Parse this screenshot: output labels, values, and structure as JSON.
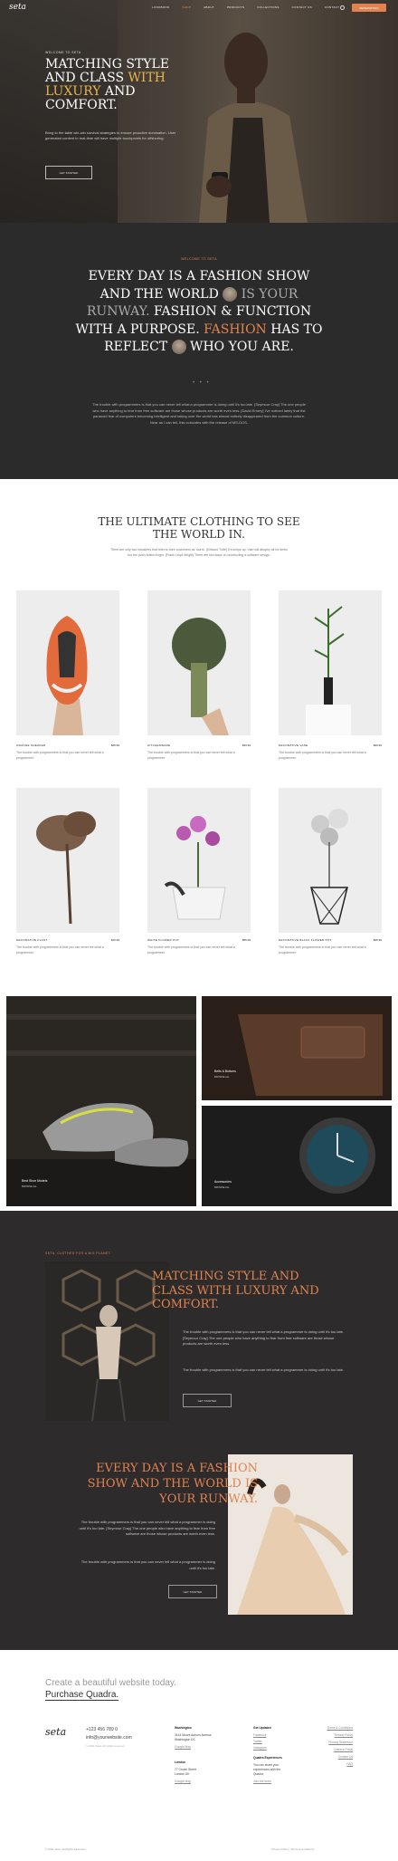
{
  "header": {
    "logo": "seta",
    "nav": [
      "LOOKBOOK",
      "SHOP",
      "ABOUT",
      "PRODUCTS",
      "COLLECTIONS",
      "CONTACT US",
      "CONTACT"
    ],
    "nav_active": 1,
    "search_label": "Search",
    "cta": "RESERVATION"
  },
  "hero": {
    "kicker": "WELCOME TO SETA",
    "title_lines": [
      "MATCHING STYLE",
      "AND CLASS "
    ],
    "title_gold": "WITH LUXURY",
    "title_end": " AND COMFORT.",
    "text": "Bring to the table win-win survival strategies to ensure proactive domination. User generated content in real-time will have multiple touchpoints for offshoring.",
    "button": "GET STARTED"
  },
  "fashion": {
    "kicker": "WELCOME TO SETA",
    "title_a": "EVERY DAY IS A FASHION SHOW AND THE WORLD ",
    "title_b": "IS YOUR RUNWAY.",
    "title_c": " FASHION & FUNCTION WITH A PURPOSE. ",
    "title_d": "FASHION",
    "title_e": " HAS TO REFLECT ",
    "title_f": " WHO YOU ARE.",
    "dots": "• • •",
    "text": "The trouble with programmers is that you can never tell what a programmer is doing until it's too late. [Seymour Cray] The one people who have anything to fear from free software are those whose products are worth even less. [David Emery] I've noticed lately that the paranoid fear of computers becoming intelligent and taking over the world has almost entirely disappeared from the common culture. Near as I can tell, this coincides with the release of MS-DOS."
  },
  "collection": {
    "title": "THE ULTIMATE CLOTHING TO SEE THE WORLD IN.",
    "text": "There are only two industries that refer to their customers as 'users'. [Edward Tufte] If it keeps up, man will atrophy all his limbs but the push-button finger. [Frank Lloyd Wright] There are two ways of constructing a software design.",
    "products": [
      {
        "name": "ORANGE SNEAKER",
        "price": "$25.99",
        "desc": "The trouble with programmers is that you can never tell what a programmer."
      },
      {
        "name": "KITCHENWARE",
        "price": "$33.99",
        "desc": "The trouble with programmers is that you can never tell what a programmer."
      },
      {
        "name": "DECORATIVE VASE",
        "price": "$29.99",
        "desc": "The trouble with programmers is that you can never tell what a programmer."
      },
      {
        "name": "DECORATIVE PLANT",
        "price": "$19.99",
        "desc": "The trouble with programmers is that you can never tell what a programmer."
      },
      {
        "name": "WHITE FLOWER POT",
        "price": "$55.99",
        "desc": "The trouble with programmers is that you can never tell what a programmer."
      },
      {
        "name": "DECORATIVE BLACK FLOWER POT",
        "price": "$45.99",
        "desc": "The trouble with programmers is that you can never tell what a programmer."
      }
    ]
  },
  "gallery": {
    "shoes_label": "Best Shoe Models",
    "shoes_sub": "BROWSE ALL",
    "belts_label": "Belts & Buttons",
    "belts_sub": "BROWSE ALL",
    "acc_label": "Accessories",
    "acc_sub": "BROWSE ALL"
  },
  "dark": {
    "kicker": "SETA. CLOTHES FOR A BIG PLANET.",
    "title": "MATCHING STYLE AND CLASS WITH LUXURY AND COMFORT.",
    "text1": "The trouble with programmers is that you can never tell what a programmer is doing until it's too late. [Seymour Cray] The one people who have anything to fear from free software are those whose products are worth even less.",
    "text2": "The trouble with programmers is that you can never tell what a programmer is doing until it's too late.",
    "button1": "GET STARTED",
    "title2": "EVERY DAY IS A FASHION SHOW AND THE WORLD IS YOUR RUNWAY.",
    "text3": "The trouble with programmers is that you can never tell what a programmer is doing until it's too late. [Seymour Cray] The one people who have anything to fear from free software are those whose products are worth even less.",
    "text4": "The trouble with programmers is that you can never tell what a programmer is doing until it's too late.",
    "button2": "GET STARTED"
  },
  "footer": {
    "promo1": "Create a beautiful website today.",
    "promo2": "Purchase Quadra.",
    "logo": "seta",
    "phone": "+123 456 789 0",
    "email": "info@yourwebsite.com",
    "copyright_small": "© 2021 Seta. All rights reserved.",
    "col1_head": "Washington",
    "col1_lines": [
      "3144 Mount Auburn Avenue",
      "Washington DC"
    ],
    "col1_link": "Google Map",
    "col2_head": "London",
    "col2_lines": [
      "77 Crown Street",
      "London UK"
    ],
    "col2_link": "Google Map",
    "col3_head": "Get Updated",
    "col3_links": [
      "Facebook",
      "Twitter",
      "Instagram"
    ],
    "col4_head": "Quadra Experiences",
    "col4_text": "You can share your experiences with the Quadra",
    "col4_link": "Join the team",
    "col5_links": [
      "Terms & Conditions",
      "Refund Policy",
      "Privacy Statement",
      "Careers Portal",
      "Contact Us",
      "FAQ"
    ],
    "bottom_left": "© 2021 Seta. All Rights Reserved.",
    "bottom_right": "Privacy Policy | Terms & Conditions"
  },
  "colors": {
    "accent": "#e2834f",
    "gold": "#e8b44e",
    "dark": "#2b2b2b"
  }
}
